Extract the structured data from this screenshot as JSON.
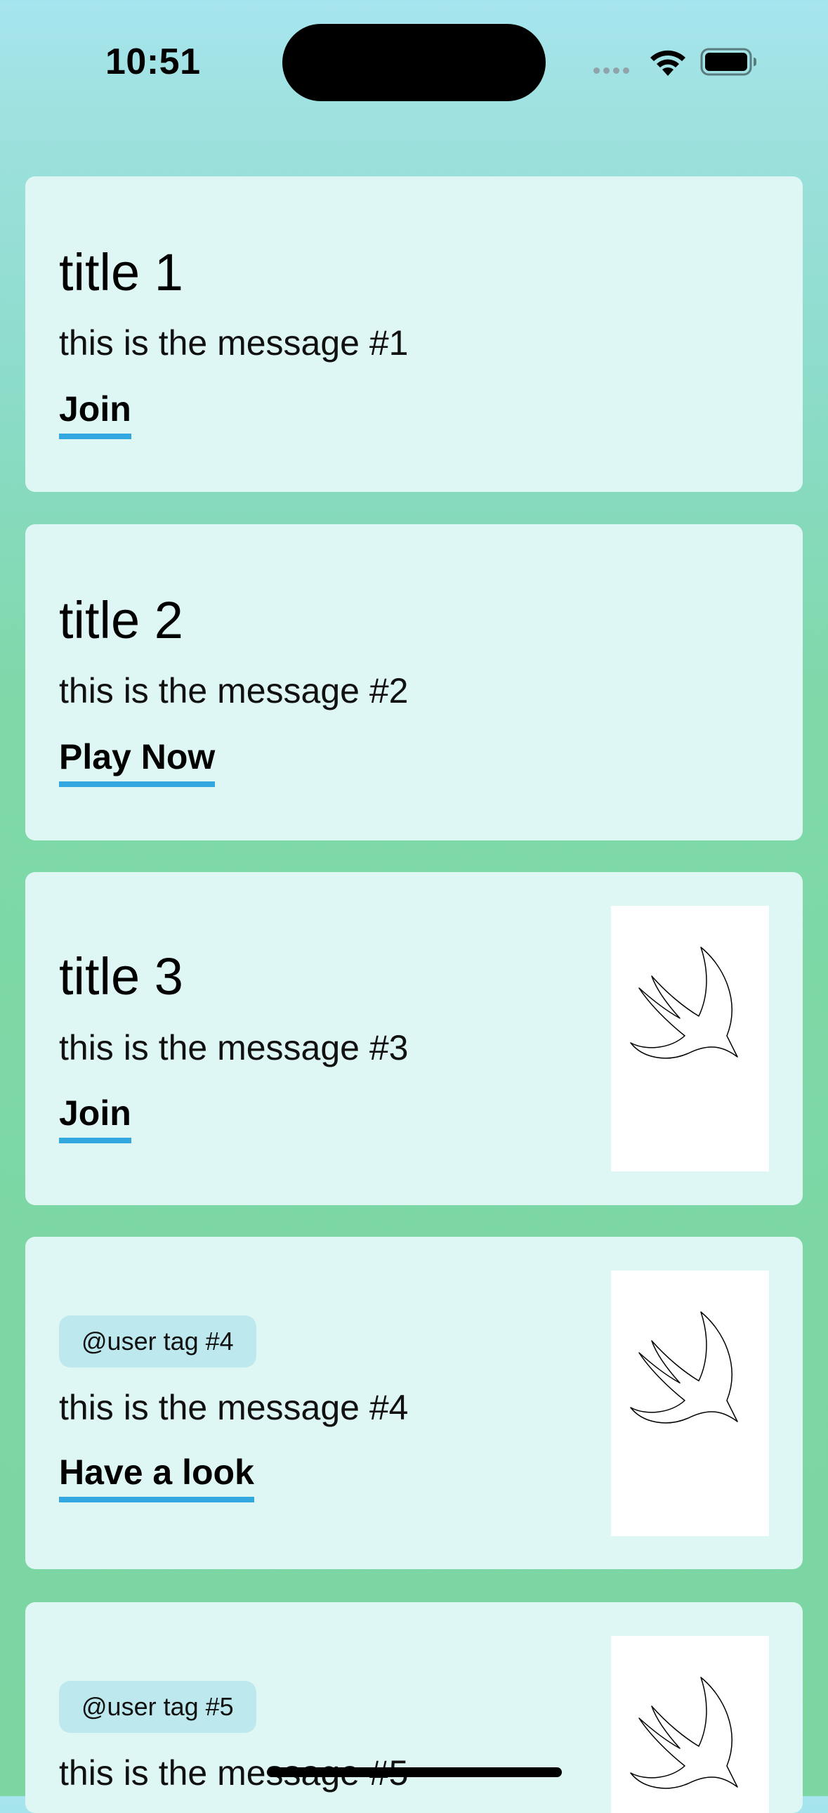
{
  "status_bar": {
    "time": "10:51",
    "signal_icon": "signal-dots-icon",
    "wifi_icon": "wifi-icon",
    "battery_icon": "battery-icon"
  },
  "cards": [
    {
      "title": "title 1",
      "message": "this is the message #1",
      "action_label": "Join"
    },
    {
      "title": "title 2",
      "message": "this is the message #2",
      "action_label": "Play Now"
    },
    {
      "title": "title 3",
      "message": "this is the message #3",
      "action_label": "Join",
      "image_icon": "swift-bird-icon"
    },
    {
      "tag": "@user tag #4",
      "message": "this is the message #4",
      "action_label": "Have a look",
      "image_icon": "swift-bird-icon"
    },
    {
      "tag": "@user tag #5",
      "message": "this is the message #5",
      "image_icon": "swift-bird-icon"
    }
  ],
  "colors": {
    "background_top": "#a6e5ef",
    "background_bottom": "#7bd6a2",
    "card": "#dff7f4",
    "tag": "#bde9ee",
    "action_underline": "#33a8e0"
  }
}
